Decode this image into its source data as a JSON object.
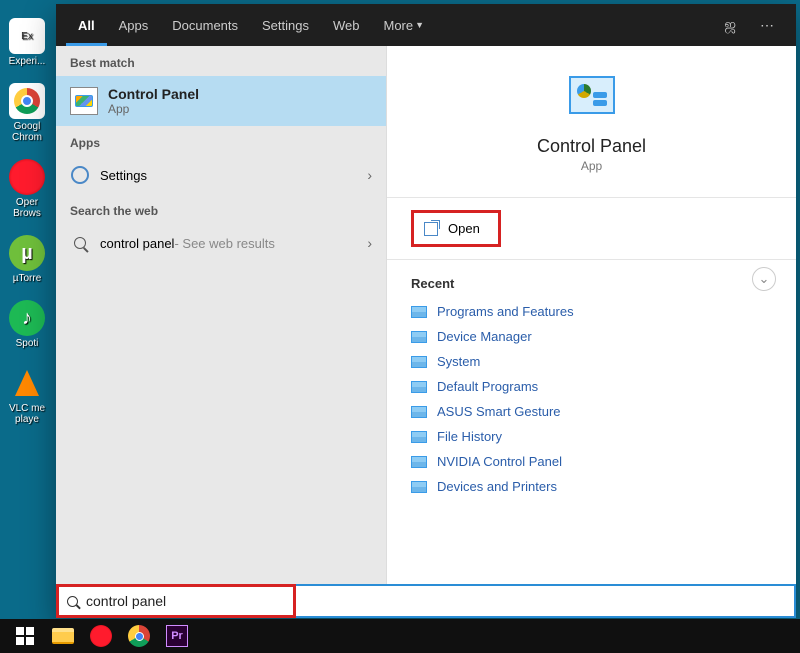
{
  "desktop": {
    "icons": [
      {
        "label": "Experi...",
        "bg": "#fff"
      },
      {
        "label": "Googl\nChrom",
        "bg": "#fff"
      },
      {
        "label": "Oper\nBrows",
        "bg": "#c22"
      },
      {
        "label": "µTorre",
        "bg": "#5a9e2e"
      },
      {
        "label": "Spoti",
        "bg": "#1DB954"
      },
      {
        "label": "VLC me\nplaye",
        "bg": "none"
      }
    ]
  },
  "tabs": {
    "items": [
      "All",
      "Apps",
      "Documents",
      "Settings",
      "Web",
      "More"
    ],
    "active": 0
  },
  "left": {
    "best_match_label": "Best match",
    "best": {
      "title": "Control Panel",
      "sub": "App"
    },
    "apps_label": "Apps",
    "apps": [
      {
        "label": "Settings"
      }
    ],
    "web_label": "Search the web",
    "web": {
      "prefix": "control panel",
      "suffix": " - See web results"
    }
  },
  "right": {
    "title": "Control Panel",
    "sub": "App",
    "open": "Open",
    "recent_label": "Recent",
    "recent": [
      "Programs and Features",
      "Device Manager",
      "System",
      "Default Programs",
      "ASUS Smart Gesture",
      "File History",
      "NVIDIA Control Panel",
      "Devices and Printers"
    ]
  },
  "search": {
    "value": "control panel"
  }
}
